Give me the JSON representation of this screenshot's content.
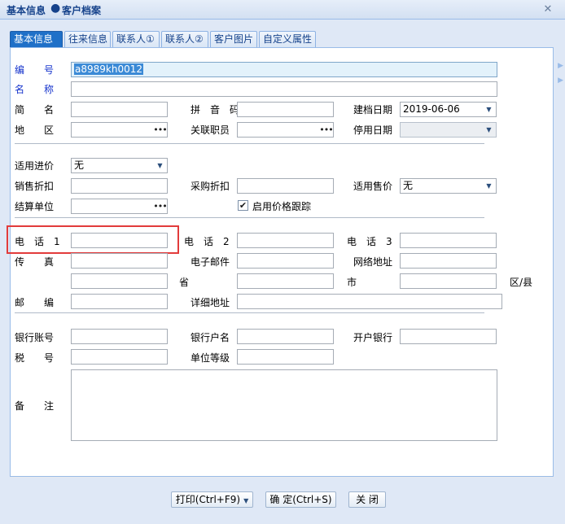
{
  "window": {
    "breadcrumb_section": "基本信息",
    "breadcrumb_page": "客户档案"
  },
  "tabs": [
    {
      "label": "基本信息",
      "active": true
    },
    {
      "label": "往来信息"
    },
    {
      "label": "联系人①"
    },
    {
      "label": "联系人②"
    },
    {
      "label": "客户图片"
    },
    {
      "label": "自定义属性"
    }
  ],
  "form": {
    "code": {
      "label": "编　　号",
      "value": "a8989kh0012"
    },
    "name": {
      "label": "名　　称",
      "value": ""
    },
    "short_name": {
      "label": "简　　名",
      "value": ""
    },
    "pinyin": {
      "label": "拼　音　码",
      "value": ""
    },
    "created_date": {
      "label": "建档日期",
      "value": "2019-06-06"
    },
    "region": {
      "label": "地　　区",
      "value": ""
    },
    "staff": {
      "label": "关联职员",
      "value": ""
    },
    "disabled_date": {
      "label": "停用日期",
      "value": ""
    },
    "purchase_price": {
      "label": "适用进价",
      "value": "无"
    },
    "sales_discount": {
      "label": "销售折扣",
      "value": ""
    },
    "purchase_discount": {
      "label": "采购折扣",
      "value": ""
    },
    "sales_price": {
      "label": "适用售价",
      "value": "无"
    },
    "settlement_unit": {
      "label": "结算单位",
      "value": ""
    },
    "price_tracking": {
      "label": "启用价格跟踪",
      "checked": true
    },
    "phone1": {
      "label": "电　话　1",
      "value": ""
    },
    "phone2": {
      "label": "电　话　2",
      "value": ""
    },
    "phone3": {
      "label": "电　话　3",
      "value": ""
    },
    "fax": {
      "label": "传　　真",
      "value": ""
    },
    "email": {
      "label": "电子邮件",
      "value": ""
    },
    "website": {
      "label": "网络地址",
      "value": ""
    },
    "address_area": {
      "value": ""
    },
    "province": {
      "label": "省",
      "value": ""
    },
    "city": {
      "label": "市",
      "value": ""
    },
    "district": {
      "label": "区/县",
      "value": ""
    },
    "postcode": {
      "label": "邮　　编",
      "value": ""
    },
    "address": {
      "label": "详细地址",
      "value": ""
    },
    "bank_account": {
      "label": "银行账号",
      "value": ""
    },
    "bank_name": {
      "label": "银行户名",
      "value": ""
    },
    "bank": {
      "label": "开户银行",
      "value": ""
    },
    "tax_no": {
      "label": "税　　号",
      "value": ""
    },
    "level": {
      "label": "单位等级",
      "value": ""
    },
    "remark": {
      "label": "备　　注",
      "value": ""
    }
  },
  "buttons": {
    "print": "打印(Ctrl+F9)",
    "confirm": "确 定(Ctrl+S)",
    "close": "关 闭"
  },
  "colors": {
    "accent": "#1f70c8",
    "highlight": "#e23b3b",
    "label_blue": "#1533cc"
  }
}
